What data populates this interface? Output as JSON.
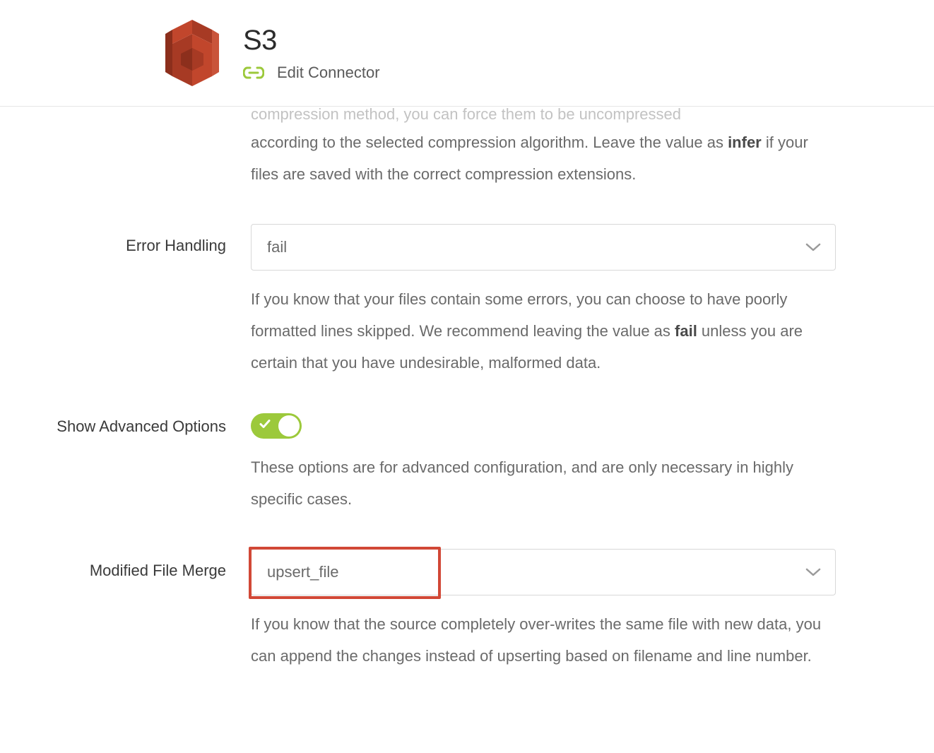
{
  "header": {
    "title": "S3",
    "edit_connector": "Edit Connector"
  },
  "truncated": {
    "line1": "compression method, you can force them to be uncompressed",
    "line2_pre": "according to the selected compression algorithm. Leave the value as ",
    "line2_bold": "infer",
    "line2_post": " if your files are saved with the correct compression extensions."
  },
  "fields": {
    "error_handling": {
      "label": "Error Handling",
      "value": "fail",
      "help_pre": "If you know that your files contain some errors, you can choose to have poorly formatted lines skipped. We recommend leaving the value as ",
      "help_bold": "fail",
      "help_post": " unless you are certain that you have undesirable, malformed data."
    },
    "show_advanced": {
      "label": "Show Advanced Options",
      "help": "These options are for advanced configuration, and are only necessary in highly specific cases."
    },
    "modified_file_merge": {
      "label": "Modified File Merge",
      "value": "upsert_file",
      "help": "If you know that the source completely over-writes the same file with new data, you can append the changes instead of upserting based on filename and line number."
    }
  }
}
